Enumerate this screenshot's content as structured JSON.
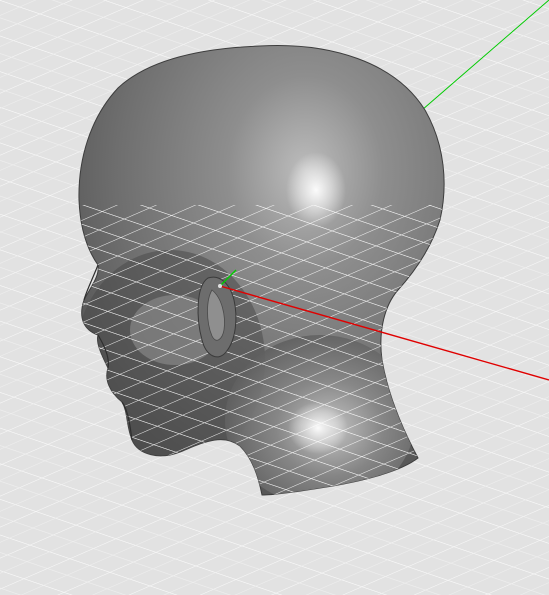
{
  "viewport": {
    "background_color": "#e4e4e4",
    "grid_line_color": "#ffffff",
    "grid_visible": true
  },
  "model": {
    "object": "head-mesh",
    "shading": "gray-smooth",
    "base_color": "#7c7c7c",
    "highlight_color": "#f2f2f2",
    "shadow_color": "#3e3e3e",
    "grid_overlay_visible": true
  },
  "axes": {
    "x_axis_color": "#e00000",
    "y_axis_color": "#00cc00",
    "visible": true
  }
}
